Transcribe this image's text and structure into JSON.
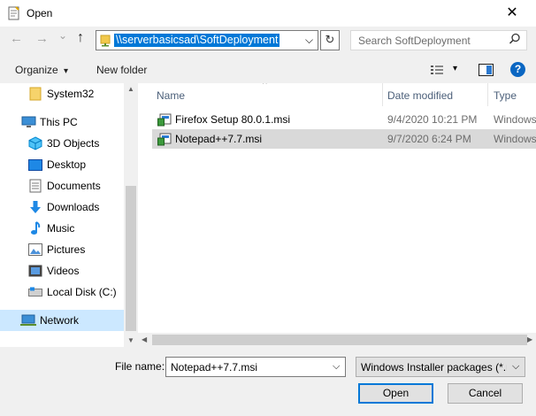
{
  "window": {
    "title": "Open",
    "close_glyph": "✕"
  },
  "nav": {
    "back_glyph": "←",
    "forward_glyph": "→",
    "recent_glyph": "⌄",
    "up_glyph": "↑",
    "address": "\\\\serverbasicsad\\SoftDeployment",
    "address_dropdown_glyph": "⌵",
    "refresh_glyph": "↻",
    "search_placeholder": "Search SoftDeployment",
    "search_glyph": "⚲"
  },
  "toolbar": {
    "organize_label": "Organize",
    "organize_arrow": "▾",
    "new_folder_label": "New folder",
    "view_arrow": "▾",
    "help_glyph": "?"
  },
  "sidebar": {
    "items": [
      {
        "label": "System32",
        "icon": "folder-icon"
      },
      {
        "label": "This PC",
        "icon": "computer-icon"
      },
      {
        "label": "3D Objects",
        "icon": "3d-objects-icon"
      },
      {
        "label": "Desktop",
        "icon": "desktop-icon"
      },
      {
        "label": "Documents",
        "icon": "documents-icon"
      },
      {
        "label": "Downloads",
        "icon": "downloads-icon"
      },
      {
        "label": "Music",
        "icon": "music-icon"
      },
      {
        "label": "Pictures",
        "icon": "pictures-icon"
      },
      {
        "label": "Videos",
        "icon": "videos-icon"
      },
      {
        "label": "Local Disk (C:)",
        "icon": "disk-icon"
      },
      {
        "label": "Network",
        "icon": "network-icon"
      }
    ]
  },
  "files": {
    "columns": {
      "name": "Name",
      "date": "Date modified",
      "type": "Type",
      "sort_glyph": "^"
    },
    "rows": [
      {
        "name": "Firefox Setup 80.0.1.msi",
        "date": "9/4/2020 10:21 PM",
        "type": "Windows"
      },
      {
        "name": "Notepad++7.7.msi",
        "date": "9/7/2020 6:24 PM",
        "type": "Windows"
      }
    ]
  },
  "footer": {
    "file_name_label": "File name:",
    "file_name_value": "Notepad++7.7.msi",
    "dropdown_glyph": "⌵",
    "file_type_value": "Windows Installer packages (*.msi)",
    "open_label": "Open",
    "cancel_label": "Cancel"
  },
  "colors": {
    "accent": "#0078d7",
    "selected_nav": "#cce8ff",
    "selected_row": "#d9d9d9"
  }
}
